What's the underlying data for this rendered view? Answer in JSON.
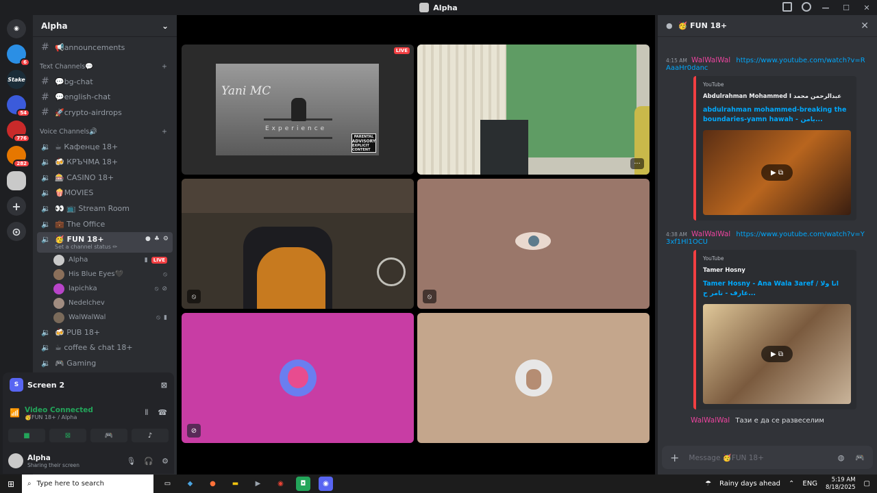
{
  "window": {
    "title": "Alpha"
  },
  "rail": {
    "badges": [
      "6",
      "54",
      "776",
      "282"
    ],
    "stake_label": "Stake"
  },
  "sidebar": {
    "guild_name": "Alpha",
    "announcements": "📢announcements",
    "text_category": "Text Channels💬",
    "text_channels": [
      "💬bg-chat",
      "💬english-chat",
      "🚀crypto-airdrops"
    ],
    "voice_category": "Voice Channels🔊",
    "voice_channels_top": [
      "☕ Кафенце 18+",
      "🍻 КРЪЧМА 18+",
      "🎰 CASINO 18+",
      "🍿MOVIES",
      "👀 📺 Stream Room",
      "💼 The Office"
    ],
    "active_channel": "🥳 FUN 18+",
    "active_status": "Set a channel status ✏",
    "members": [
      {
        "name": "Alpha",
        "live": "LIVE"
      },
      {
        "name": "His Blue Eyes🖤"
      },
      {
        "name": "lapichka"
      },
      {
        "name": "Nedelchev"
      },
      {
        "name": "WalWalWal"
      }
    ],
    "voice_channels_bottom": [
      "🍻 PUB 18+",
      "☕ coffee & chat 18+",
      "🎮 Gaming"
    ]
  },
  "voice_panel": {
    "screen_label": "Screen 2",
    "screen_icon_letter": "S",
    "status": "Video Connected",
    "location": "🥳FUN 18+ / Alpha",
    "user_name": "Alpha",
    "user_status": "Sharing their screen"
  },
  "stage": {
    "live_label": "LIVE",
    "yani_title": "Yani MC",
    "yani_sub": "Experience",
    "advisory_1": "PARENTAL",
    "advisory_2": "ADVISORY",
    "advisory_3": "EXPLICIT CONTENT",
    "more_label": "···"
  },
  "chat": {
    "channel": "🥳 FUN 18+",
    "messages": [
      {
        "time": "4:15 AM",
        "author": "WalWalWal",
        "link": "https://www.youtube.com/watch?v=RAaaHr0danc",
        "embed": {
          "provider": "YouTube",
          "author": "Abdulrahman Mohammed I عبدالرحمن محمد",
          "title": "abdulrahman mohammed-breaking the boundaries-yamn hawah - يامن..."
        }
      },
      {
        "time": "4:38 AM",
        "author": "WalWalWal",
        "link": "https://www.youtube.com/watch?v=Y3xf1Hl1OCU",
        "embed": {
          "provider": "YouTube",
          "author": "Tamer Hosny",
          "title": "Tamer Hosny - Ana Wala 3aref / انا ولا عارف - تامر ح..."
        }
      },
      {
        "author": "WalWalWal",
        "text": "Тази е да се развеселим"
      }
    ],
    "input_placeholder": "Message 🥳FUN 18+"
  },
  "taskbar": {
    "search_placeholder": "Type here to search",
    "weather": "Rainy days ahead",
    "lang": "ENG",
    "time": "5:19 AM",
    "date": "8/18/2025"
  },
  "colors": {
    "accent": "#5865f2",
    "live": "#f23f42",
    "connected": "#23a55a",
    "author": "#eb459e",
    "link": "#00a8fc"
  }
}
